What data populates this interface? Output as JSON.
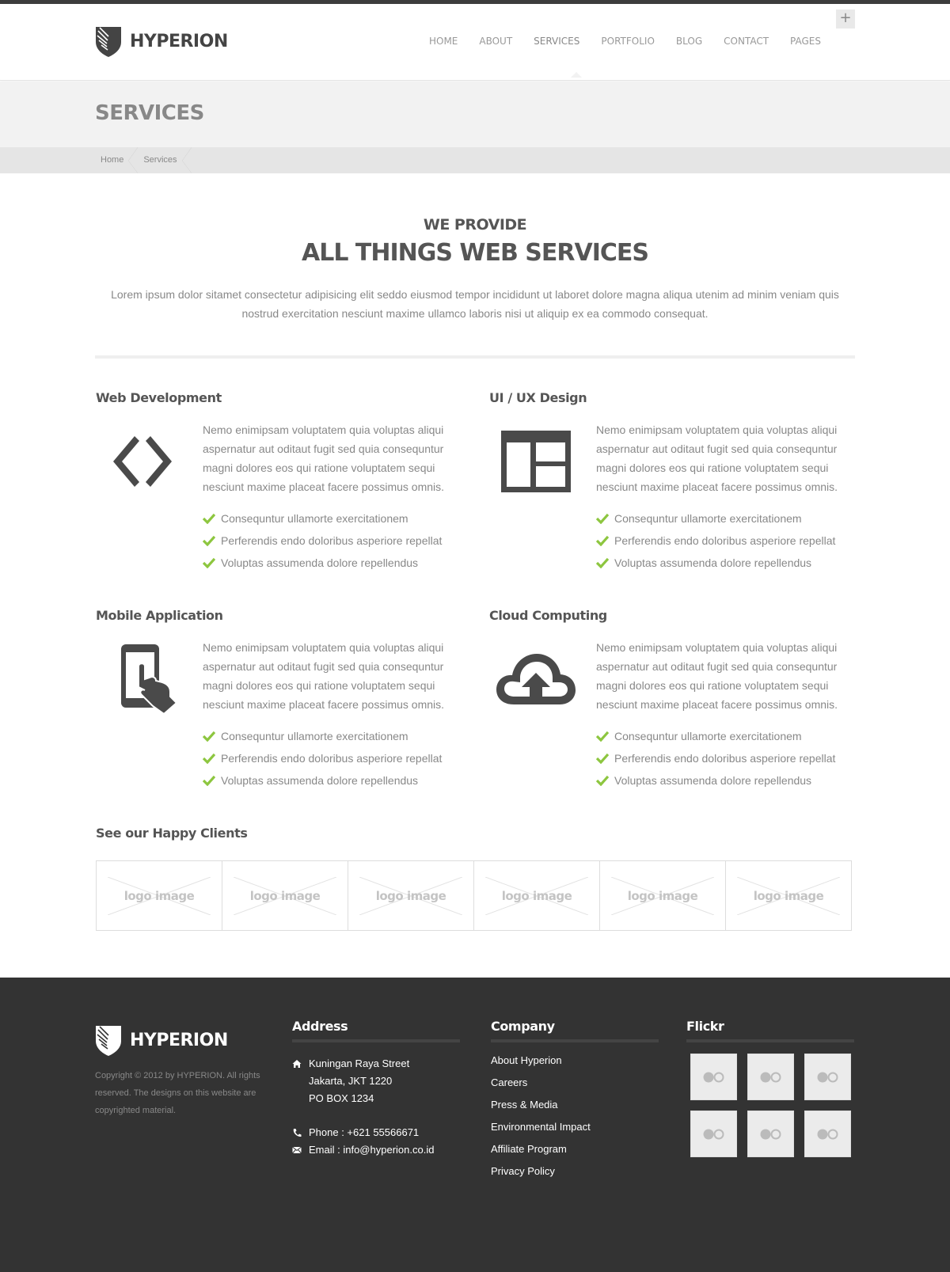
{
  "header": {
    "brand": "HYPERION",
    "nav": [
      "HOME",
      "ABOUT",
      "SERVICES",
      "PORTFOLIO",
      "BLOG",
      "CONTACT",
      "PAGES"
    ],
    "plus_label": "+"
  },
  "page": {
    "title": "SERVICES",
    "breadcrumb": [
      "Home",
      "Services"
    ]
  },
  "intro": {
    "subtitle": "WE PROVIDE",
    "title": "ALL THINGS WEB SERVICES",
    "text": "Lorem ipsum dolor sitamet consectetur adipisicing elit seddo eiusmod tempor incididunt ut laboret dolore magna aliqua utenim ad minim veniam quis nostrud exercitation nesciunt maxime ullamco laboris nisi ut aliquip ex ea commodo consequat."
  },
  "services": [
    {
      "title": "Web Development",
      "icon": "code-icon",
      "desc": "Nemo enimipsam voluptatem quia voluptas aliqui aspernatur aut oditaut fugit sed quia consequntur magni dolores eos qui ratione voluptatem sequi nesciunt maxime placeat facere possimus omnis.",
      "items": [
        "Consequntur ullamorte exercitationem",
        "Perferendis endo doloribus asperiore repellat",
        "Voluptas assumenda dolore repellendus"
      ]
    },
    {
      "title": "UI / UX Design",
      "icon": "layout-icon",
      "desc": "Nemo enimipsam voluptatem quia voluptas aliqui aspernatur aut oditaut fugit sed quia consequntur magni dolores eos qui ratione voluptatem sequi nesciunt maxime placeat facere possimus omnis.",
      "items": [
        "Consequntur ullamorte exercitationem",
        "Perferendis endo doloribus asperiore repellat",
        "Voluptas assumenda dolore repellendus"
      ]
    },
    {
      "title": "Mobile Application",
      "icon": "mobile-touch-icon",
      "desc": "Nemo enimipsam voluptatem quia voluptas aliqui aspernatur aut oditaut fugit sed quia consequntur magni dolores eos qui ratione voluptatem sequi nesciunt maxime placeat facere possimus omnis.",
      "items": [
        "Consequntur ullamorte exercitationem",
        "Perferendis endo doloribus asperiore repellat",
        "Voluptas assumenda dolore repellendus"
      ]
    },
    {
      "title": "Cloud Computing",
      "icon": "cloud-upload-icon",
      "desc": "Nemo enimipsam voluptatem quia voluptas aliqui aspernatur aut oditaut fugit sed quia consequntur magni dolores eos qui ratione voluptatem sequi nesciunt maxime placeat facere possimus omnis.",
      "items": [
        "Consequntur ullamorte exercitationem",
        "Perferendis endo doloribus asperiore repellat",
        "Voluptas assumenda dolore repellendus"
      ]
    }
  ],
  "clients": {
    "title": "See our Happy Clients",
    "logos": [
      "logo image",
      "logo image",
      "logo image",
      "logo image",
      "logo image",
      "logo image"
    ]
  },
  "footer": {
    "brand": "HYPERION",
    "copyright": "Copyright © 2012 by HYPERION. All rights reserved. The designs on this website are copyrighted material.",
    "address": {
      "title": "Address",
      "lines": [
        "Kuningan Raya Street",
        "Jakarta, JKT 1220",
        "PO BOX 1234"
      ],
      "phone": "Phone : +621 55566671",
      "email": "Email : info@hyperion.co.id"
    },
    "company": {
      "title": "Company",
      "links": [
        "About Hyperion",
        "Careers",
        "Press & Media",
        "Environmental Impact",
        "Affiliate Program",
        "Privacy Policy"
      ]
    },
    "flickr": {
      "title": "Flickr",
      "thumb_count": 6
    }
  },
  "colors": {
    "accent_check": "#8dc63f",
    "dark": "#333333",
    "icon": "#4a4a4a"
  }
}
